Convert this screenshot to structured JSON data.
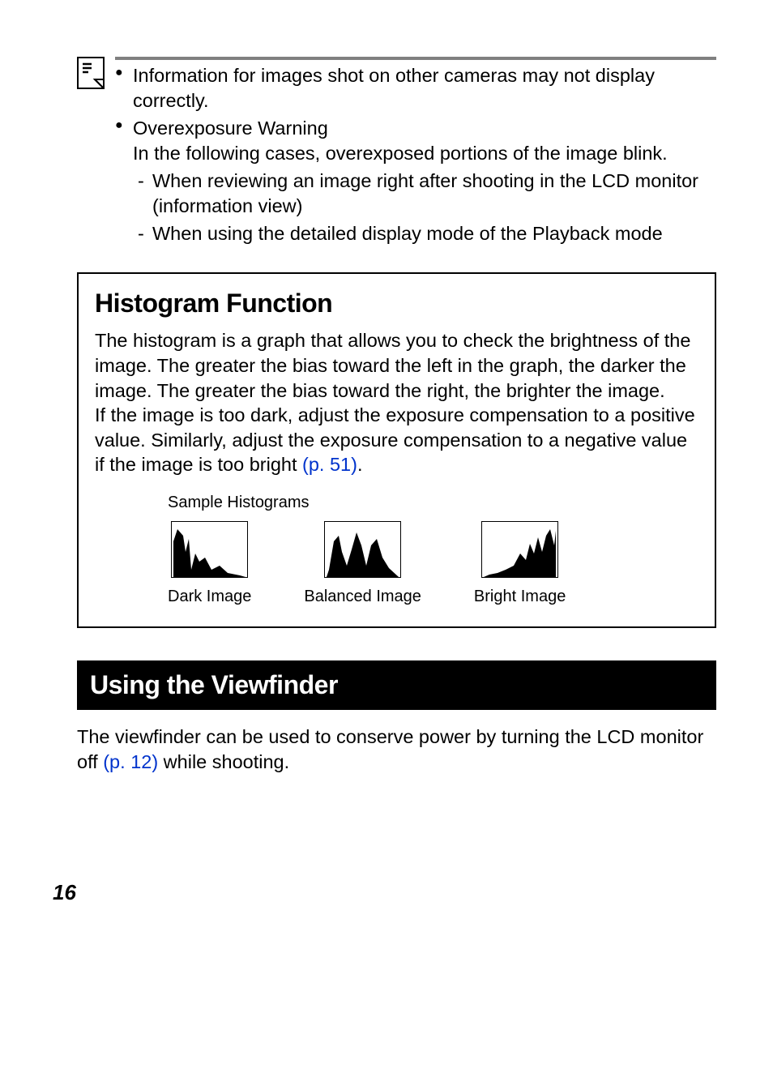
{
  "note": {
    "bullet1": "Information for images shot on other cameras may not display correctly.",
    "bullet2_title": "Overexposure Warning",
    "bullet2_body": "In the following cases, overexposed portions of the image blink.",
    "dash1": "When reviewing an image right after shooting in the LCD monitor (information view)",
    "dash2": "When using the detailed display mode of the Playback mode"
  },
  "histogram": {
    "title": "Histogram Function",
    "body1": "The histogram is a graph that allows you to check the brightness of the image. The greater the bias toward the left in the graph, the darker the image. The greater the bias toward the right, the brighter the image.",
    "body2a": "If the image is too dark, adjust the exposure compensation to a positive value. Similarly, adjust the exposure compensation to a negative value if the image is too bright ",
    "body2_link": "(p. 51)",
    "body2b": ".",
    "samples_label": "Sample Histograms",
    "captions": {
      "dark": "Dark Image",
      "balanced": "Balanced Image",
      "bright": "Bright Image"
    }
  },
  "viewfinder": {
    "title": "Using the Viewfinder",
    "body_a": "The viewfinder can be used to conserve power by turning the LCD monitor off ",
    "body_link": "(p. 12)",
    "body_b": " while shooting."
  },
  "page_number": "16"
}
